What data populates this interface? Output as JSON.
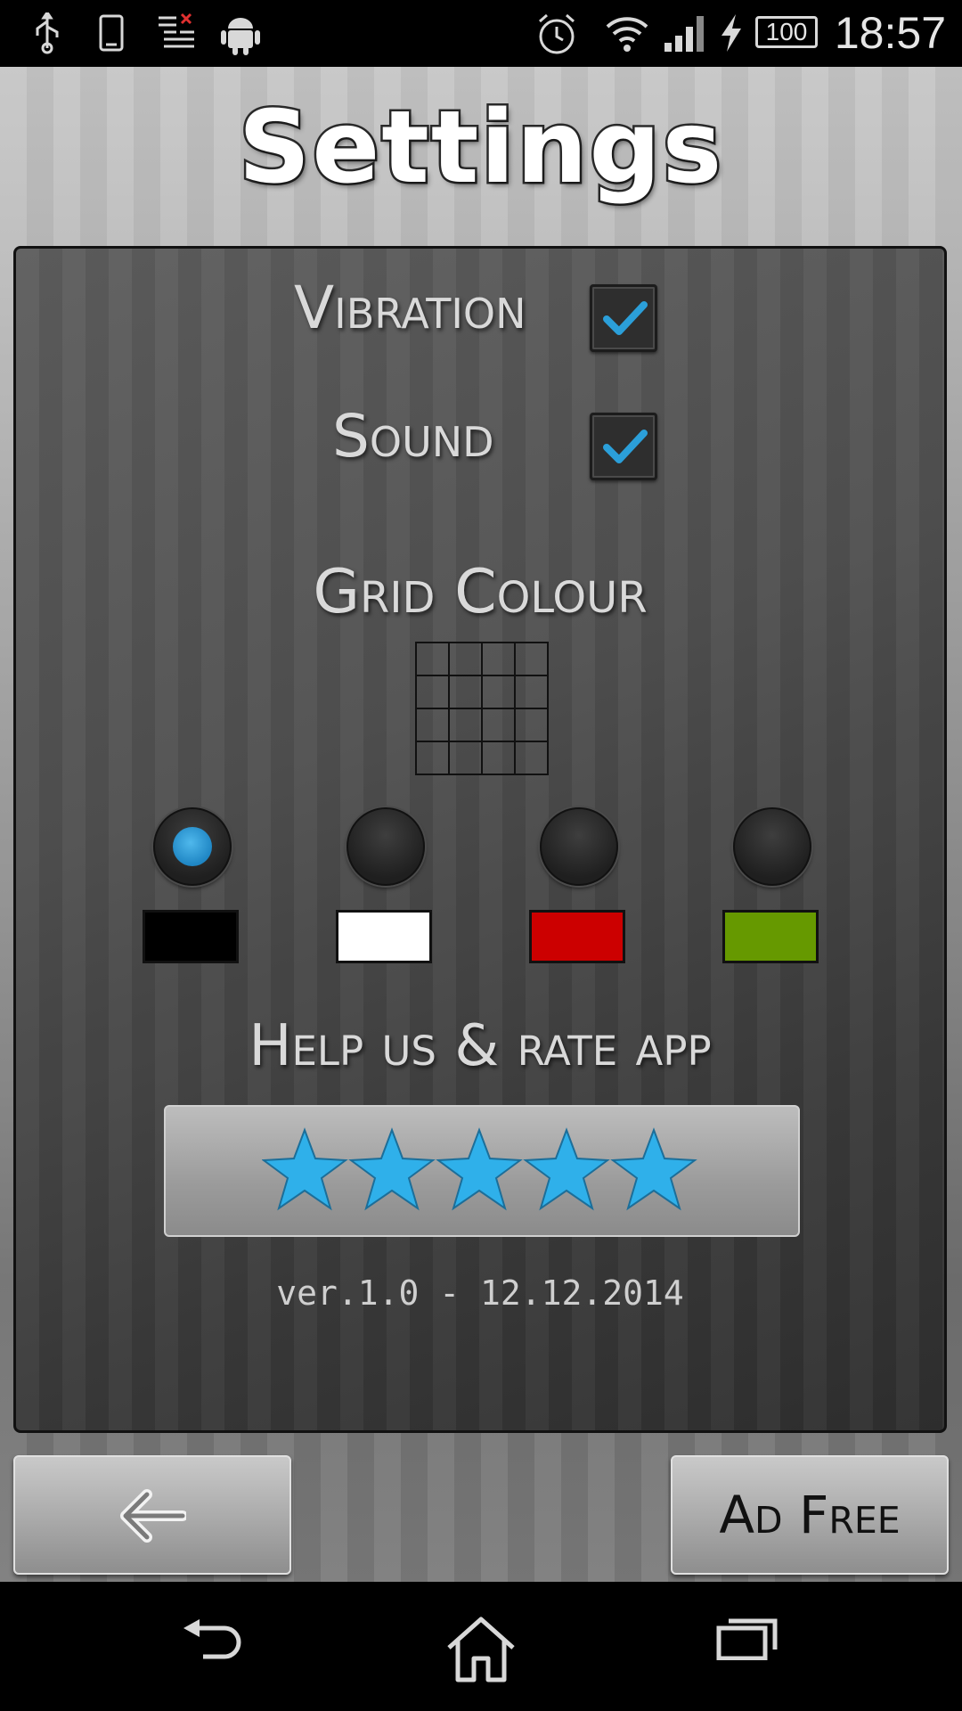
{
  "status_bar": {
    "time": "18:57",
    "battery_level": "100",
    "icons": [
      "usb-icon",
      "phone-icon",
      "notification-list-icon",
      "android-icon",
      "alarm-icon",
      "wifi-icon",
      "signal-icon",
      "charging-icon",
      "battery-icon"
    ]
  },
  "app": {
    "title": "Settings"
  },
  "settings": {
    "vibration_label": "Vibration",
    "vibration_checked": true,
    "sound_label": "Sound",
    "sound_checked": true,
    "grid_colour_label": "Grid Colour",
    "grid_colour_options": [
      {
        "name": "black",
        "color": "#000000",
        "selected": true
      },
      {
        "name": "white",
        "color": "#ffffff",
        "selected": false
      },
      {
        "name": "red",
        "color": "#cc0000",
        "selected": false
      },
      {
        "name": "green",
        "color": "#669900",
        "selected": false
      }
    ],
    "accent_color": "#2b9fd9",
    "rate_label": "Help us & rate app",
    "rate_stars": 5,
    "star_color": "#2fb0ea",
    "version": "ver.1.0 - 12.12.2014"
  },
  "footer": {
    "back_icon": "arrow-left-icon",
    "ad_free_label": "Ad Free"
  },
  "navbar": {
    "icons": [
      "nav-back-icon",
      "nav-home-icon",
      "nav-recents-icon"
    ]
  }
}
